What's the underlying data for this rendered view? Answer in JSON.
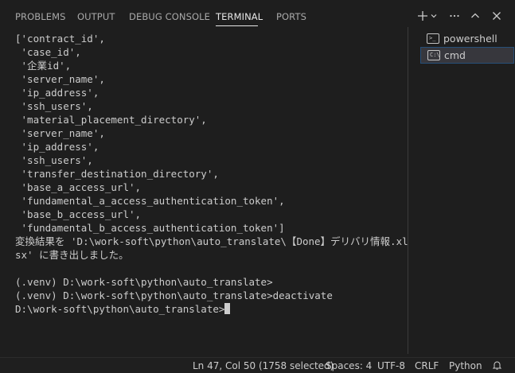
{
  "panel": {
    "tabs": [
      {
        "label": "PROBLEMS"
      },
      {
        "label": "OUTPUT"
      },
      {
        "label": "DEBUG CONSOLE"
      },
      {
        "label": "TERMINAL",
        "active": true
      },
      {
        "label": "PORTS"
      }
    ],
    "actions": [
      "plus-icon",
      "chevron-down-icon",
      "ellipsis-icon",
      "chevron-up-icon",
      "close-icon"
    ]
  },
  "terminal": {
    "lines": [
      "['contract_id',",
      " 'case_id',",
      " '企業id',",
      " 'server_name',",
      " 'ip_address',",
      " 'ssh_users',",
      " 'material_placement_directory',",
      " 'server_name',",
      " 'ip_address',",
      " 'ssh_users',",
      " 'transfer_destination_directory',",
      " 'base_a_access_url',",
      " 'fundamental_a_access_authentication_token',",
      " 'base_b_access_url',",
      " 'fundamental_b_access_authentication_token']",
      "変換結果を 'D:\\work-soft\\python\\auto_translate\\【Done】デリバリ情報.xl",
      "sx' に書き出しました。",
      "",
      "(.venv) D:\\work-soft\\python\\auto_translate>",
      "(.venv) D:\\work-soft\\python\\auto_translate>deactivate",
      "D:\\work-soft\\python\\auto_translate>"
    ]
  },
  "sidebar": {
    "terminals": [
      {
        "label": "powershell",
        "icon": "terminal-icon"
      },
      {
        "label": "cmd",
        "icon": "cmd-icon",
        "selected": true
      }
    ]
  },
  "status": {
    "position": "Ln 47, Col 50 (1758 selected)",
    "spaces": "Spaces: 4",
    "encoding": "UTF-8",
    "eol": "CRLF",
    "language": "Python"
  }
}
